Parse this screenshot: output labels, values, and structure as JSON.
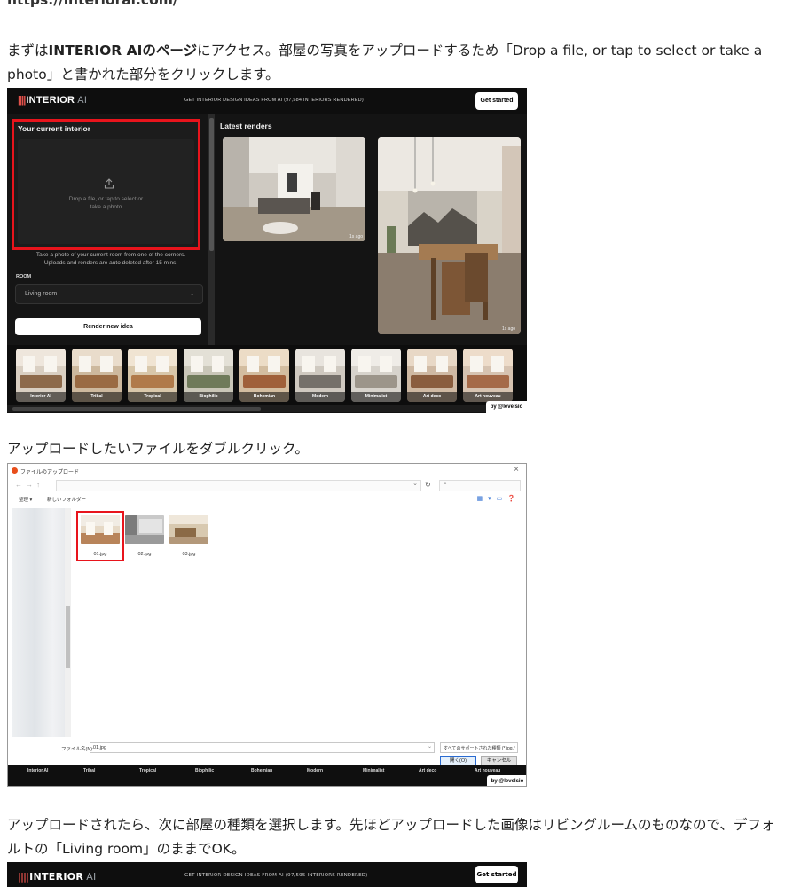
{
  "url_line": "https://interiorai.com/",
  "para1": {
    "pre": "まずは",
    "bold": "INTERIOR AIのページ",
    "post": "にアクセス。部屋の写真をアップロードするため「Drop a file, or tap to select or take a photo」と書かれた部分をクリックします。"
  },
  "interior_ai": {
    "logo_bars": "||||",
    "logo_text": "INTERIOR",
    "logo_ai": "AI",
    "tagline": "GET INTERIOR DESIGN IDEAS FROM AI (97,584 INTERIORS RENDERED)",
    "get_started": "Get started",
    "current_interior_title": "Your current interior",
    "drop_text_line1": "Drop a file, or tap to select or",
    "drop_text_line2": "take a photo",
    "hint_line1": "Take a photo of your current room from one of the corners.",
    "hint_line2": "Uploads and renders are auto deleted after 15 mins.",
    "room_label": "ROOM",
    "room_value": "Living room",
    "render_button": "Render new idea",
    "latest_renders_title": "Latest renders",
    "time_ago": "1s ago",
    "styles": [
      "Interior AI",
      "Tribal",
      "Tropical",
      "Biophilic",
      "Bohemian",
      "Modern",
      "Minimalist",
      "Art deco",
      "Art nouveau"
    ],
    "credit": "by @levelsio"
  },
  "para2": "アップロードしたいファイルをダブルクリック。",
  "file_dialog": {
    "title": "ファイルのアップロード",
    "organize": "整理 ▾",
    "new_folder": "新しいフォルダー",
    "files": [
      "01.jpg",
      "02.jpg",
      "03.jpg"
    ],
    "filename_label": "ファイル名(N):",
    "filename_value": "01.jpg",
    "filetype_value": "すべてのサポートされた種類 (*.jpg,*",
    "open_button": "開く(O)",
    "cancel_button": "キャンセル",
    "strip_labels": [
      "Interior AI",
      "Tribal",
      "Tropical",
      "Biophilic",
      "Bohemian",
      "Modern",
      "Minimalist",
      "Art deco",
      "Art nouveau"
    ],
    "credit": "by @levelsio"
  },
  "para3": "アップロードされたら、次に部屋の種類を選択します。先ほどアップロードした画像はリビングルームのものなので、デフォルトの「Living room」のままでOK。",
  "shot3": {
    "logo_bars": "||||",
    "logo_text": "INTERIOR",
    "logo_ai": "AI",
    "tagline": "GET INTERIOR DESIGN IDEAS FROM AI (97,595 INTERIORS RENDERED)",
    "get_started": "Get started"
  },
  "colors": {
    "highlight_red": "#e8141c",
    "logo_red": "#e0504a",
    "dark_bg": "#111111"
  }
}
